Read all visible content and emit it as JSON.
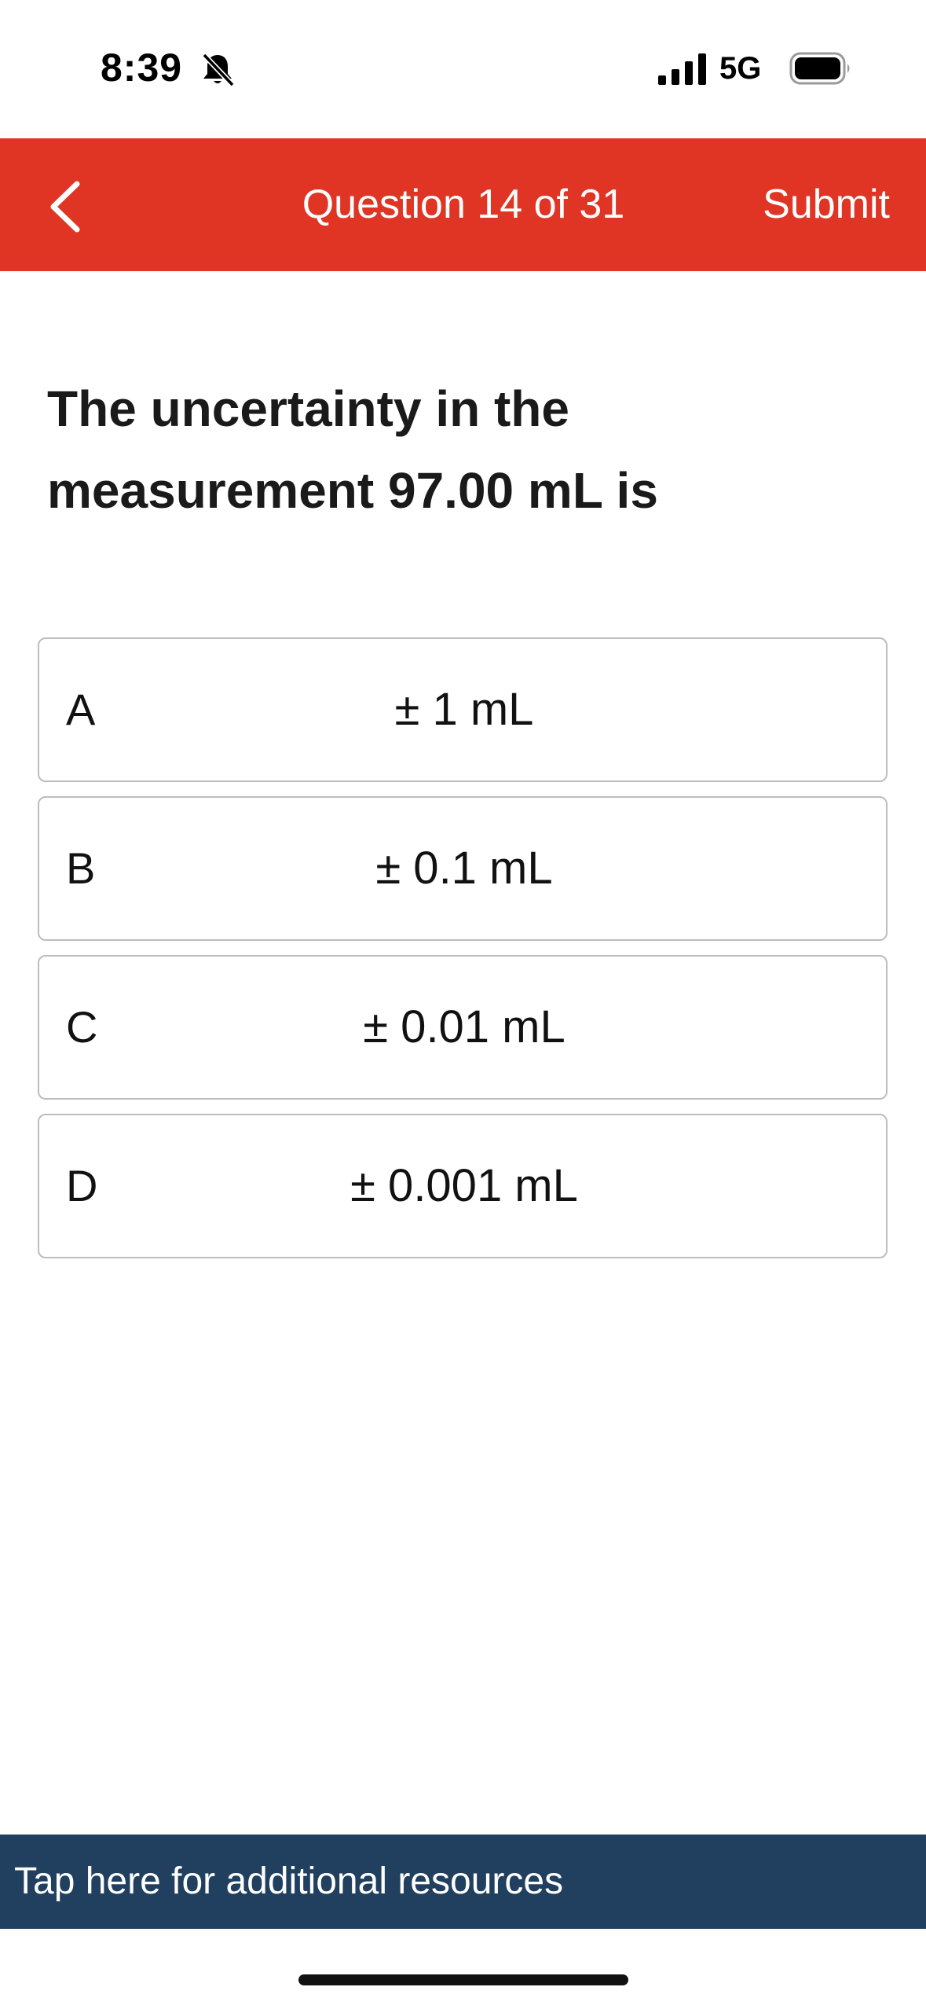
{
  "status_bar": {
    "time": "8:39",
    "network": "5G",
    "icons": [
      "bell-off-icon",
      "signal-icon",
      "battery-icon"
    ]
  },
  "header": {
    "title": "Question 14 of 31",
    "submit_label": "Submit",
    "back_icon": "chevron-left-icon",
    "background_color": "#e03524"
  },
  "question": {
    "text": "The uncertainty in the measurement 97.00 mL is"
  },
  "options": [
    {
      "letter": "A",
      "value": "± 1 mL"
    },
    {
      "letter": "B",
      "value": "± 0.1 mL"
    },
    {
      "letter": "C",
      "value": "± 0.01 mL"
    },
    {
      "letter": "D",
      "value": "± 0.001 mL"
    }
  ],
  "resources": {
    "label": "Tap here for additional resources",
    "background_color": "#213f5e"
  }
}
